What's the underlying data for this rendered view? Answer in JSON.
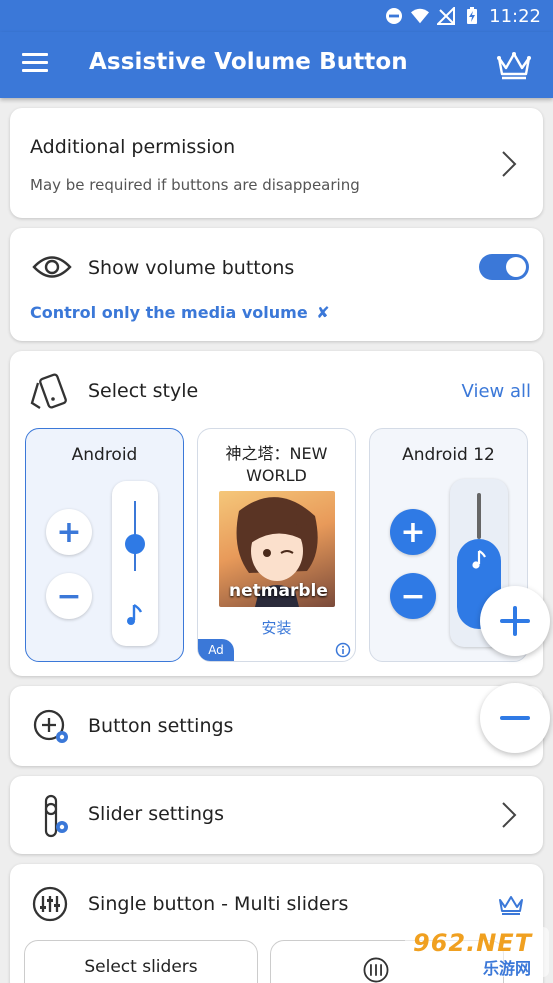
{
  "status_bar": {
    "time": "11:22"
  },
  "app_bar": {
    "title": "Assistive Volume Button"
  },
  "permission": {
    "title": "Additional permission",
    "subtitle": "May be required if buttons are disappearing"
  },
  "show_buttons": {
    "title": "Show volume buttons",
    "toggle_on": true,
    "media_link": "Control only the media volume",
    "media_link_icon": "✘"
  },
  "style": {
    "title": "Select style",
    "view_all": "View all",
    "cards": [
      {
        "name": "Android",
        "selected": true
      },
      {
        "name": "神之塔：NEW WORLD",
        "install": "安装",
        "ad": "Ad",
        "logo": "netmarble"
      },
      {
        "name": "Android 12",
        "selected": false
      }
    ]
  },
  "button_settings": {
    "title": "Button settings"
  },
  "slider_settings": {
    "title": "Slider settings"
  },
  "single_button": {
    "title": "Single button - Multi sliders",
    "select_sliders": "Select sliders"
  },
  "watermark": {
    "text": "962.NET",
    "sub": "乐游网"
  },
  "colors": {
    "accent": "#3b78d8",
    "background": "#eeeeee"
  }
}
